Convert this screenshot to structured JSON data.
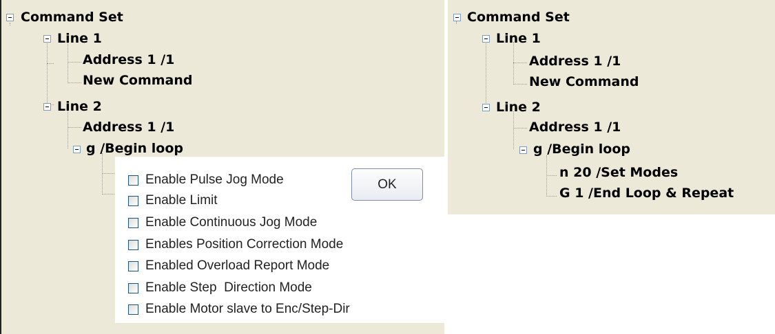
{
  "left_tree": {
    "root": "Command Set",
    "line1": {
      "label": "Line 1",
      "children": [
        "Address 1 /1",
        "New Command"
      ]
    },
    "line2": {
      "label": "Line 2",
      "address": "Address 1 /1",
      "loop": "g /Begin loop"
    }
  },
  "dialog": {
    "ok_label": "OK",
    "options": [
      "Enable Pulse Jog Mode",
      "Enable Limit",
      "Enable Continuous Jog Mode",
      "Enables Position Correction Mode",
      "Enabled Overload Report Mode",
      "Enable Step  Direction Mode",
      "Enable Motor slave to Enc/Step-Dir"
    ]
  },
  "right_tree": {
    "root": "Command Set",
    "line1": {
      "label": "Line 1",
      "children": [
        "Address 1 /1",
        "New Command"
      ]
    },
    "line2": {
      "label": "Line 2",
      "address": "Address 1 /1",
      "loop": "g /Begin loop",
      "loop_children": [
        "n 20 /Set Modes",
        "G 1 /End Loop & Repeat"
      ]
    }
  }
}
